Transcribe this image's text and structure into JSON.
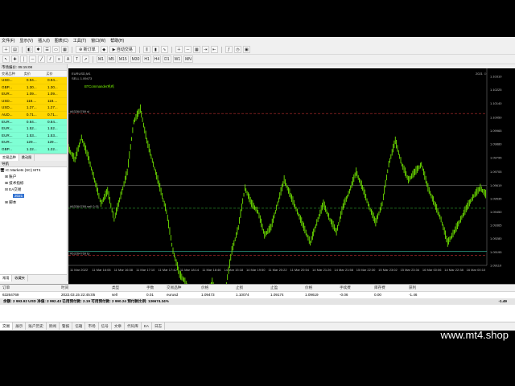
{
  "menu": [
    "文件(F)",
    "显示(V)",
    "插入(I)",
    "图表(C)",
    "工具(T)",
    "窗口(W)",
    "帮助(H)"
  ],
  "toolbar": {
    "new_order": "新订单",
    "auto_trading": "自动交易",
    "periods": [
      "M1",
      "M5",
      "M15",
      "M30",
      "H1",
      "H4",
      "D1",
      "W1",
      "MN"
    ]
  },
  "market_watch": {
    "title": "市场报价: 05:15:08",
    "columns": [
      "交易品种",
      "卖价",
      "买价"
    ],
    "rows": [
      {
        "symbol": "USD...",
        "bid": "0.94...",
        "ask": "0.94...",
        "color": "#ffd700"
      },
      {
        "symbol": "GBP...",
        "bid": "1.30...",
        "ask": "1.30...",
        "color": "#ffd700"
      },
      {
        "symbol": "EUR...",
        "bid": "1.09...",
        "ask": "1.09...",
        "color": "#ffd700"
      },
      {
        "symbol": "USD...",
        "bid": "118....",
        "ask": "118....",
        "color": "#ffd700"
      },
      {
        "symbol": "USD...",
        "bid": "1.27...",
        "ask": "1.27...",
        "color": "#ffd700"
      },
      {
        "symbol": "AUD...",
        "bid": "0.71...",
        "ask": "0.71...",
        "color": "#ffd700"
      },
      {
        "symbol": "EUR...",
        "bid": "0.84...",
        "ask": "0.84...",
        "color": "#7fffd4"
      },
      {
        "symbol": "EUR...",
        "bid": "1.52...",
        "ask": "1.52...",
        "color": "#7fffd4"
      },
      {
        "symbol": "EUR...",
        "bid": "1.53...",
        "ask": "1.53...",
        "color": "#7fffd4"
      },
      {
        "symbol": "EUR...",
        "bid": "129....",
        "ask": "129....",
        "color": "#7fffd4"
      },
      {
        "symbol": "GBP...",
        "bid": "1.22...",
        "ask": "1.22...",
        "color": "#7fffd4"
      }
    ],
    "tabs": [
      "交易品种",
      "跳动图"
    ]
  },
  "navigator": {
    "title": "导航",
    "items": [
      "IC Markets (SC) MT4",
      "账户",
      "技术指标",
      "EA交易",
      "2021",
      "脚本"
    ],
    "tabs": [
      "常用",
      "收藏夹"
    ]
  },
  "chart": {
    "symbol_info": "EURUSD,M1",
    "subinfo": "SELL 1.09473",
    "ea_name": "BTCommander鸡鸡",
    "corner": "2021 ☺",
    "chart_data": {
      "type": "line",
      "title": "EURUSD,M1",
      "y_ticks": [
        "1.10310",
        "1.10225",
        "1.10140",
        "1.10050",
        "1.09965",
        "1.09880",
        "1.09795",
        "1.09705",
        "1.09619",
        "1.09535",
        "1.09450",
        "1.09365",
        "1.09280",
        "1.09195",
        "1.09110"
      ],
      "ylim": [
        1.0911,
        1.1031
      ],
      "x_ticks": [
        "11 Mar 2022",
        "11 Mar 16:06",
        "11 Mar 16:38",
        "11 Mar 17:10",
        "11 Mar 17:42",
        "11 Mar 18:14",
        "11 Mar 18:46",
        "14 Mar 15:18",
        "14 Mar 19:50",
        "11 Mar 20:22",
        "11 Mar 20:54",
        "14 Mar 21:26",
        "14 Mar 21:58",
        "15 Mar 22:30",
        "15 Mar 23:02",
        "15 Mar 23:34",
        "16 Mar 00:06",
        "14 Mar 22:38",
        "16 Mar 00:10"
      ],
      "price_labels": [
        "#63264769 sl",
        "#63264769 sell 0.01",
        "#63264769 tp"
      ],
      "series": [
        {
          "name": "EURUSD",
          "values": [
            1.0985,
            1.0978,
            1.0992,
            1.098,
            1.0965,
            1.095,
            1.0958,
            1.094,
            1.0955,
            1.097,
            1.1002,
            1.101,
            1.099,
            1.0975,
            1.096,
            1.0945,
            1.092,
            1.0905,
            1.09,
            1.0885,
            1.0895,
            1.089,
            1.09,
            1.0888,
            1.0895,
            1.092,
            1.0935,
            1.096,
            1.095,
            1.0945,
            1.093,
            1.0935,
            1.095,
            1.0965,
            1.0955,
            1.0945,
            1.0935,
            1.0925,
            1.0938,
            1.095,
            1.094,
            1.0932,
            1.0948,
            1.0958,
            1.097,
            1.096,
            1.0948,
            1.0938,
            1.095,
            1.0975,
            1.099,
            1.0975,
            1.0965,
            1.097,
            1.0975,
            1.096,
            1.095,
            1.094,
            1.0925,
            1.0932,
            1.094,
            1.0948,
            1.0955,
            1.096,
            1.0955
          ]
        }
      ]
    }
  },
  "terminal": {
    "columns": [
      "订单",
      "时间",
      "类型",
      "手数",
      "交易品种",
      "价格",
      "止损",
      "止盈",
      "价格",
      "手续费",
      "库存费",
      "获利"
    ],
    "order": [
      "63264769",
      "2022.03.15 22:45:05",
      "sell",
      "0.01",
      "eurusd",
      "1.09473",
      "1.10074",
      "1.09174",
      "1.09619",
      "-0.06",
      "0.00",
      "-1.46"
    ],
    "balance_line": "余额: 2 993.92 USD  净值: 2 992.43  已用预付款: 2.19  可用预付款: 2 990.24  预付款比例: 136674.34%",
    "balance_total": "-1.49",
    "tabs": [
      "交易",
      "展示",
      "账户历史",
      "新闻",
      "警报",
      "信箱",
      "市场",
      "信号",
      "文章",
      "代码库",
      "EA",
      "日志"
    ]
  },
  "watermark": "www.mt4.shop"
}
